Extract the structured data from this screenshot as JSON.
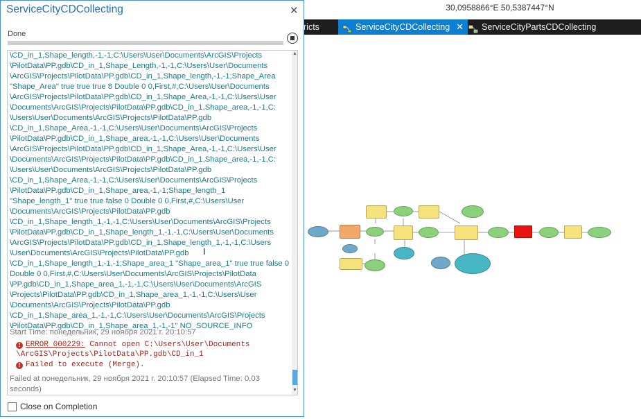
{
  "coordinates": "30,0958866°E 50,5387447°N",
  "tabs": [
    {
      "label": "ricts",
      "active": false
    },
    {
      "label": "ServiceCityCDCollecting",
      "active": true
    },
    {
      "label": "ServiceCityPartsCDCollecting",
      "active": false
    }
  ],
  "dialog": {
    "title": "ServiceCityCDCollecting",
    "status": "Done",
    "log_lines": [
      "\\CD_in_1,Shape_length,-1,-1,C:\\Users\\User\\Documents\\ArcGIS\\Projects",
      "\\PilotData\\PP.gdb\\CD_in_1,Shape_Length,-1,-1,C:\\Users\\User\\Documents",
      "\\ArcGIS\\Projects\\PilotData\\PP.gdb\\CD_in_1,Shape_length,-1,-1;Shape_Area",
      "\"Shape_Area\" true true true 8 Double 0 0,First,#,C:\\Users\\User\\Documents",
      "\\ArcGIS\\Projects\\PilotData\\PP.gdb\\CD_in_1,Shape_Area,-1,-1,C:\\Users\\User",
      "\\Documents\\ArcGIS\\Projects\\PilotData\\PP.gdb\\CD_in_1,Shape_area,-1,-1,C:",
      "\\Users\\User\\Documents\\ArcGIS\\Projects\\PilotData\\PP.gdb",
      "\\CD_in_1,Shape_Area,-1,-1,C:\\Users\\User\\Documents\\ArcGIS\\Projects",
      "\\PilotData\\PP.gdb\\CD_in_1,Shape_area,-1,-1,C:\\Users\\User\\Documents",
      "\\ArcGIS\\Projects\\PilotData\\PP.gdb\\CD_in_1,Shape_Area,-1,-1,C:\\Users\\User",
      "\\Documents\\ArcGIS\\Projects\\PilotData\\PP.gdb\\CD_in_1,Shape_area,-1,-1,C:",
      "\\Users\\User\\Documents\\ArcGIS\\Projects\\PilotData\\PP.gdb",
      "\\CD_in_1,Shape_Area,-1,-1,C:\\Users\\User\\Documents\\ArcGIS\\Projects",
      "\\PilotData\\PP.gdb\\CD_in_1,Shape_area,-1,-1;Shape_length_1",
      "\"Shape_length_1\" true true false 0 Double 0 0,First,#,C:\\Users\\User",
      "\\Documents\\ArcGIS\\Projects\\PilotData\\PP.gdb",
      "\\CD_in_1,Shape_length_1,-1,-1,C:\\Users\\User\\Documents\\ArcGIS\\Projects",
      "\\PilotData\\PP.gdb\\CD_in_1,Shape_length_1,-1,-1,C:\\Users\\User\\Documents",
      "\\ArcGIS\\Projects\\PilotData\\PP.gdb\\CD_in_1,Shape_length_1,-1,-1,C:\\Users",
      "\\User\\Documents\\ArcGIS\\Projects\\PilotData\\PP.gdb",
      "\\CD_in_1,Shape_length_1,-1,-1;Shape_area_1 \"Shape_area_1\" true true false 0",
      "Double 0 0,First,#,C:\\Users\\User\\Documents\\ArcGIS\\Projects\\PilotData",
      "\\PP.gdb\\CD_in_1,Shape_area_1,-1,-1,C:\\Users\\User\\Documents\\ArcGIS",
      "\\Projects\\PilotData\\PP.gdb\\CD_in_1,Shape_area_1,-1,-1,C:\\Users\\User",
      "\\Documents\\ArcGIS\\Projects\\PilotData\\PP.gdb",
      "\\CD_in_1,Shape_area_1,-1,-1,C:\\Users\\User\\Documents\\ArcGIS\\Projects",
      "\\PilotData\\PP.gdb\\CD_in_1,Shape_area_1,-1,-1\" NO_SOURCE_INFO"
    ],
    "start_time": "Start Time: понедельник, 29 ноября 2021 г. 20:10:57",
    "error_code": "ERROR 000229:",
    "error_msg1": " Cannot open C:\\Users\\User\\Documents",
    "error_msg2": "\\ArcGIS\\Projects\\PilotData\\PP.gdb\\CD_in_1",
    "error_msg3": "Failed to execute (Merge).",
    "failed_line": "Failed at понедельник, 29 ноября 2021 г. 20:10:57 (Elapsed Time: 0,03 seconds)",
    "close_on_completion": "Close on Completion"
  },
  "colors": {
    "accent": "#1f6fb5",
    "log_text": "#1d7a88",
    "error": "#a6261e",
    "tab_active": "#0c7fd0"
  }
}
